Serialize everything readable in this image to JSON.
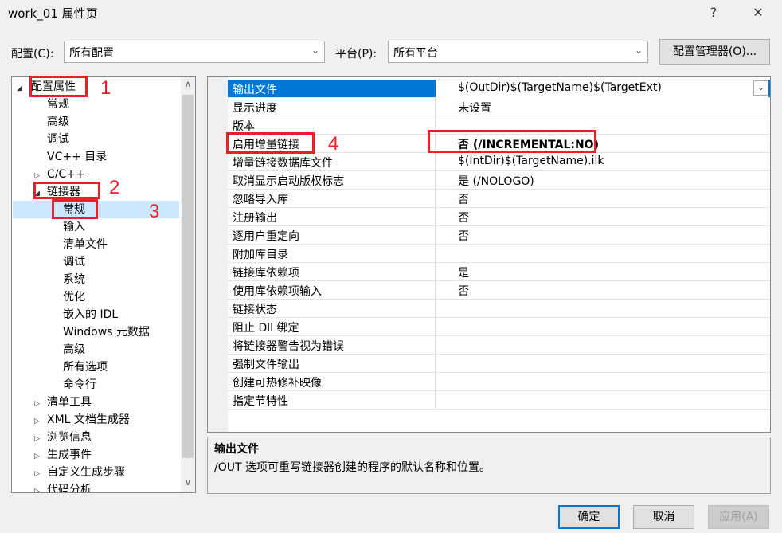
{
  "window": {
    "title": "work_01 属性页",
    "help_label": "?",
    "close_label": "✕"
  },
  "config": {
    "label": "配置(C):",
    "value": "所有配置",
    "platform_label": "平台(P):",
    "platform_value": "所有平台",
    "manager_label": "配置管理器(O)..."
  },
  "tree": {
    "items": [
      {
        "label": "配置属性"
      },
      {
        "label": "常规"
      },
      {
        "label": "高级"
      },
      {
        "label": "调试"
      },
      {
        "label": "VC++ 目录"
      },
      {
        "label": "C/C++"
      },
      {
        "label": "链接器"
      },
      {
        "label": "常规"
      },
      {
        "label": "输入"
      },
      {
        "label": "清单文件"
      },
      {
        "label": "调试"
      },
      {
        "label": "系统"
      },
      {
        "label": "优化"
      },
      {
        "label": "嵌入的 IDL"
      },
      {
        "label": "Windows 元数据"
      },
      {
        "label": "高级"
      },
      {
        "label": "所有选项"
      },
      {
        "label": "命令行"
      },
      {
        "label": "清单工具"
      },
      {
        "label": "XML 文档生成器"
      },
      {
        "label": "浏览信息"
      },
      {
        "label": "生成事件"
      },
      {
        "label": "自定义生成步骤"
      },
      {
        "label": "代码分析"
      }
    ]
  },
  "properties": {
    "rows": [
      {
        "name": "输出文件",
        "value": "$(OutDir)$(TargetName)$(TargetExt)"
      },
      {
        "name": "显示进度",
        "value": "未设置"
      },
      {
        "name": "版本",
        "value": ""
      },
      {
        "name": "启用增量链接",
        "value": "否 (/INCREMENTAL:NO)"
      },
      {
        "name": "增量链接数据库文件",
        "value": "$(IntDir)$(TargetName).ilk"
      },
      {
        "name": "取消显示启动版权标志",
        "value": "是 (/NOLOGO)"
      },
      {
        "name": "忽略导入库",
        "value": "否"
      },
      {
        "name": "注册输出",
        "value": "否"
      },
      {
        "name": "逐用户重定向",
        "value": "否"
      },
      {
        "name": "附加库目录",
        "value": ""
      },
      {
        "name": "链接库依赖项",
        "value": "是"
      },
      {
        "name": "使用库依赖项输入",
        "value": "否"
      },
      {
        "name": "链接状态",
        "value": ""
      },
      {
        "name": "阻止 Dll 绑定",
        "value": ""
      },
      {
        "name": "将链接器警告视为错误",
        "value": ""
      },
      {
        "name": "强制文件输出",
        "value": ""
      },
      {
        "name": "创建可热修补映像",
        "value": ""
      },
      {
        "name": "指定节特性",
        "value": ""
      }
    ]
  },
  "description": {
    "title": "输出文件",
    "text": "/OUT 选项可重写链接器创建的程序的默认名称和位置。"
  },
  "buttons": {
    "ok": "确定",
    "cancel": "取消",
    "apply": "应用(A)"
  },
  "annotations": [
    "1",
    "2",
    "3",
    "4"
  ],
  "colors": {
    "accent": "#0078d7",
    "annotation_red": "#e8202a",
    "tree_selection": "#cce8ff"
  }
}
